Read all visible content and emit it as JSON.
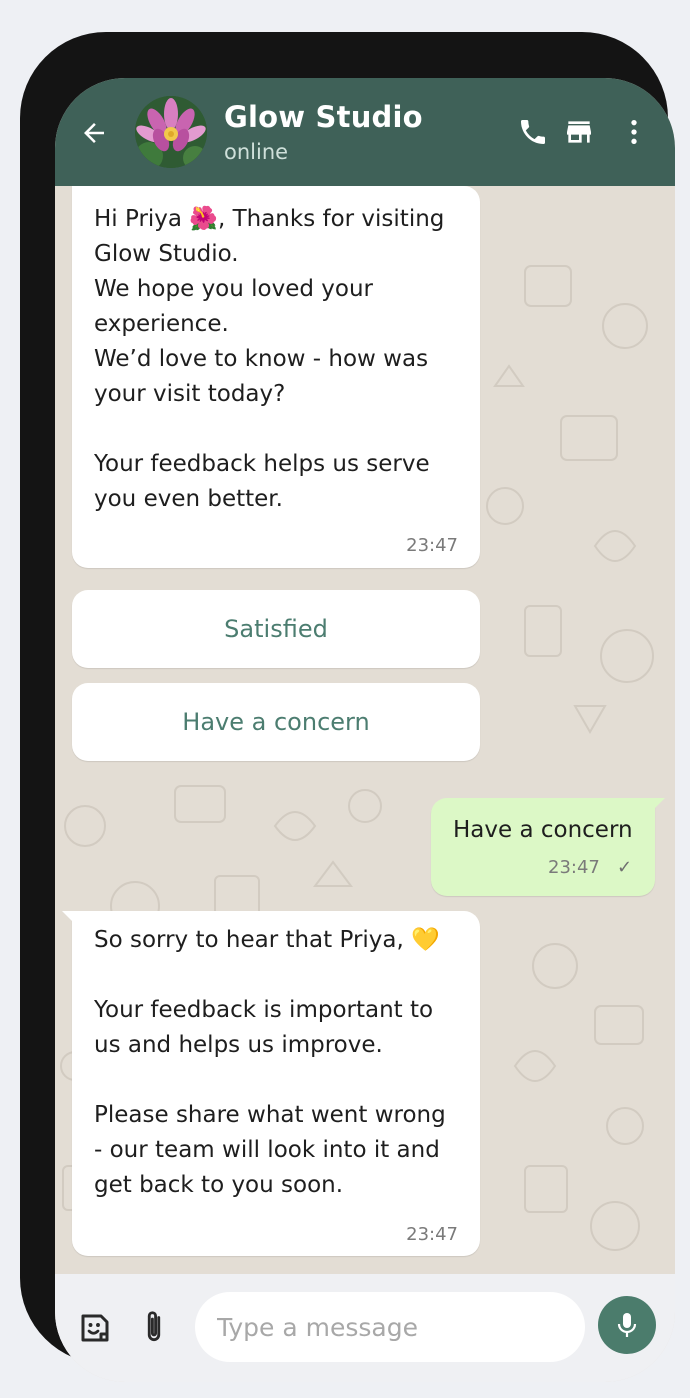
{
  "contact": {
    "name": "Glow Studio",
    "status": "online",
    "avatar_icon": "lotus-flower"
  },
  "header_icons": [
    "back-arrow-icon",
    "phone-icon",
    "store-icon",
    "more-vert-icon"
  ],
  "messages": [
    {
      "direction": "incoming",
      "text": "Hi Priya 🌺, Thanks for visiting\nGlow Studio.\nWe hope you loved your\nexperience.\nWe’d love to know - how was\nyour visit today?\n\nYour feedback helps us serve\nyou even better.",
      "time": "23:47"
    },
    {
      "direction": "outgoing",
      "text": "Have a concern",
      "time": "23:47",
      "receipt": "✓"
    },
    {
      "direction": "incoming",
      "text": "So sorry to hear that Priya, 💛\n\nYour feedback is important to\nus and helps us improve.\n\nPlease share what went wrong\n- our team will look into it and\nget back to you soon.",
      "time": "23:47"
    }
  ],
  "quick_replies": [
    "Satisfied",
    "Have a concern"
  ],
  "composer": {
    "placeholder": "Type a message",
    "value": ""
  },
  "colors": {
    "header": "#3f6158",
    "chat_background": "#e3ddd4",
    "outgoing_bubble": "#dcf8c6",
    "quick_reply_text": "#4c7d70",
    "mic_button": "#4b7c6c"
  }
}
